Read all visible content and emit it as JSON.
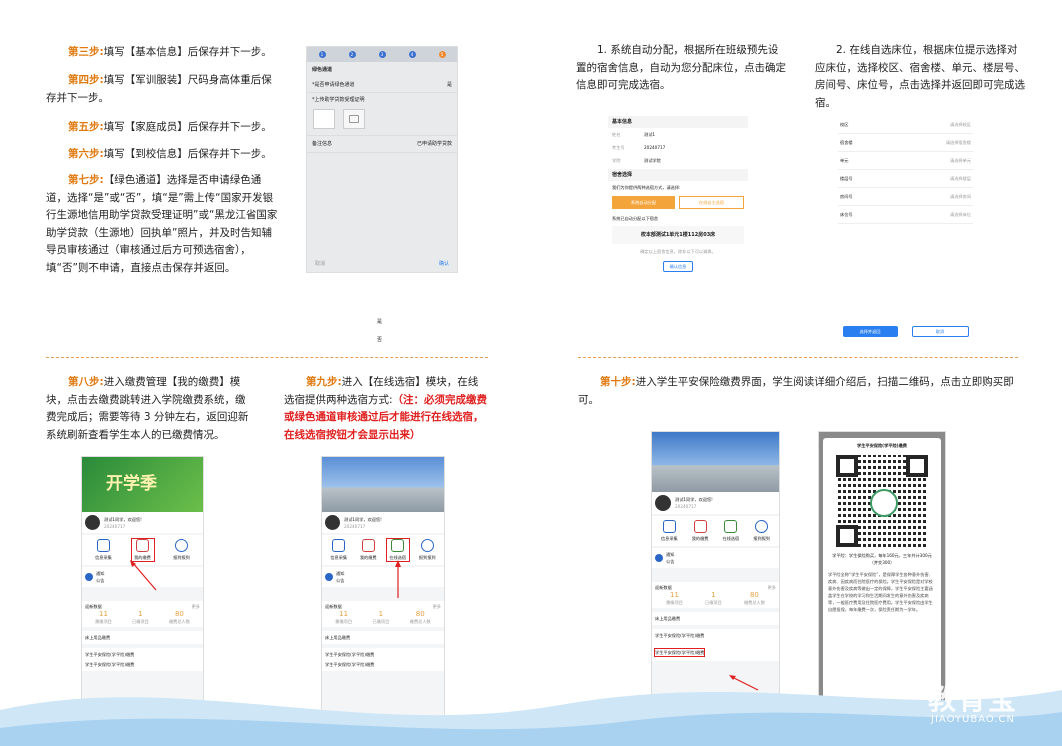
{
  "left_steps": {
    "step3": {
      "label": "第三步:",
      "text": "填写【基本信息】后保存并下一步。"
    },
    "step4": {
      "label": "第四步:",
      "text": "填写【军训服装】尺码身高体重后保存并下一步。"
    },
    "step5": {
      "label": "第五步:",
      "text": "填写【家庭成员】后保存并下一步。"
    },
    "step6": {
      "label": "第六步:",
      "text": "填写【到校信息】后保存并下一步。"
    },
    "step7": {
      "label": "第七步:",
      "text": "【绿色通道】选择是否申请绿色通道，选择“是”或“否”，填“是”需上传“国家开发银行生源地信用助学贷款受理证明”或“黑龙江省国家助学贷款（生源地）回执单”照片，并及时告知辅导员审核通过（审核通过后方可预选宿舍），填“否”则不申请，直接点击保存并返回。"
    }
  },
  "green_phone": {
    "title": "绿色通道",
    "q1": "*是否申请绿色通道",
    "q1_value": "是",
    "q2": "*上传助学贷款受理证明",
    "row3": "备注信息",
    "row3_value": "已申请助学贷款",
    "cancel": "取消",
    "confirm": "确认",
    "steps": [
      "1",
      "2",
      "3",
      "4",
      "5"
    ],
    "option_yes": "是",
    "option_no": "否"
  },
  "right_top": {
    "p1": "1. 系统自动分配，根据所在班级预先设置的宿舍信息，自动为您分配床位，点击确定信息即可完成选宿。",
    "p2": "2. 在线自选床位，根据床位提示选择对应床位，选择校区、宿舍楼、单元、楼层号、房间号、床位号，点击选择并返回即可完成选宿。"
  },
  "auto_panel": {
    "section1": "基本信息",
    "name_label": "姓名",
    "name_value": "测试1",
    "id_label": "考生号",
    "id_value": "20240717",
    "school_label": "学院",
    "school_value": "测试学院",
    "section2": "宿舍选择",
    "hint": "我们为你提供两种选宿方式，请选择:",
    "btn_auto": "系统自动分配",
    "btn_self": "在线自主选宿",
    "auto_result_label": "系统已自动分配以下宿舍",
    "room": "校本部测试1单元1楼112房03床",
    "notice": "确定以上宿舍信息，除非以下可以调换。",
    "confirm": "确认信息"
  },
  "self_panel": {
    "rows": [
      {
        "label": "校区",
        "value": "请选择校区"
      },
      {
        "label": "宿舍楼",
        "value": "请选择宿舍楼"
      },
      {
        "label": "单元",
        "value": "请选择单元"
      },
      {
        "label": "楼层号",
        "value": "请选择楼层"
      },
      {
        "label": "房间号",
        "value": "请选择房间"
      },
      {
        "label": "床位号",
        "value": "请选择床位"
      }
    ],
    "select_btn": "选择并返回",
    "cancel_btn": "取消"
  },
  "bottom_left": {
    "step8_label": "第八步:",
    "step8_text": "进入缴费管理【我的缴费】模块，点击去缴费跳转进入学院缴费系统，缴费完成后；需要等待 3 分钟左右，返回迎新系统刷新查看学生本人的已缴费情况。",
    "step9_label": "第九步:",
    "step9_text": "进入【在线选宿】模块，在线选宿提供两种选宿方式:",
    "step9_note": "（注：必须完成缴费或绿色通道审核通过后才能进行在线选宿，在线选宿按钮才会显示出来）"
  },
  "bottom_right": {
    "step10_label": "第十步:",
    "step10_text": "进入学生平安保险缴费界面，学生阅读详细介绍后，扫描二维码，点击立即购买即可。"
  },
  "app_phone": {
    "banner_title": "开学季",
    "greeting": "测试1同学，欢迎您!",
    "student_id": "20240717",
    "icons": [
      "信息采集",
      "我的缴费",
      "在线选宿",
      "报到报到"
    ],
    "notice_label": "通知",
    "notice_sub": "公告",
    "fee_title": "迎新数据",
    "fee_more": "更多",
    "fee_stats": [
      {
        "num": "11",
        "label": "需缴项目"
      },
      {
        "num": "1",
        "label": "已缴项目"
      },
      {
        "num": "80",
        "label": "缴费总人数"
      }
    ],
    "section_a": "床上用品缴费",
    "section_b": "学生平安保险(学平险)缴费",
    "section_b_item": "学生平安保险(学平险)缴费"
  },
  "insurance_popup": {
    "title": "学生平安保险(学平险)缴费",
    "price_line": "学平险：学生保险购买，每年160元，三年共计300元（并交300）",
    "body": "学平险全称“学生平安保险”，是保障学生各种意外伤害、疾病、因疾病而住院医疗的保险。学生平安保险是对学校意外伤害及疾病等做出一定的保障，学生平安保险主要涵盖学生在学校的学习和生活期间发生的意外伤害及疾病等，一般医疗费用及住院医疗费用。学生平安保险由学生自愿投保，每年缴费一次，保险责任期为一学年。",
    "close": "关闭"
  },
  "watermark": {
    "cn": "教育宝",
    "en": "JIAOYUBAO.CN"
  },
  "colors": {
    "accent": "#e07a10",
    "red": "#e02020",
    "blue": "#2a7ff0"
  }
}
